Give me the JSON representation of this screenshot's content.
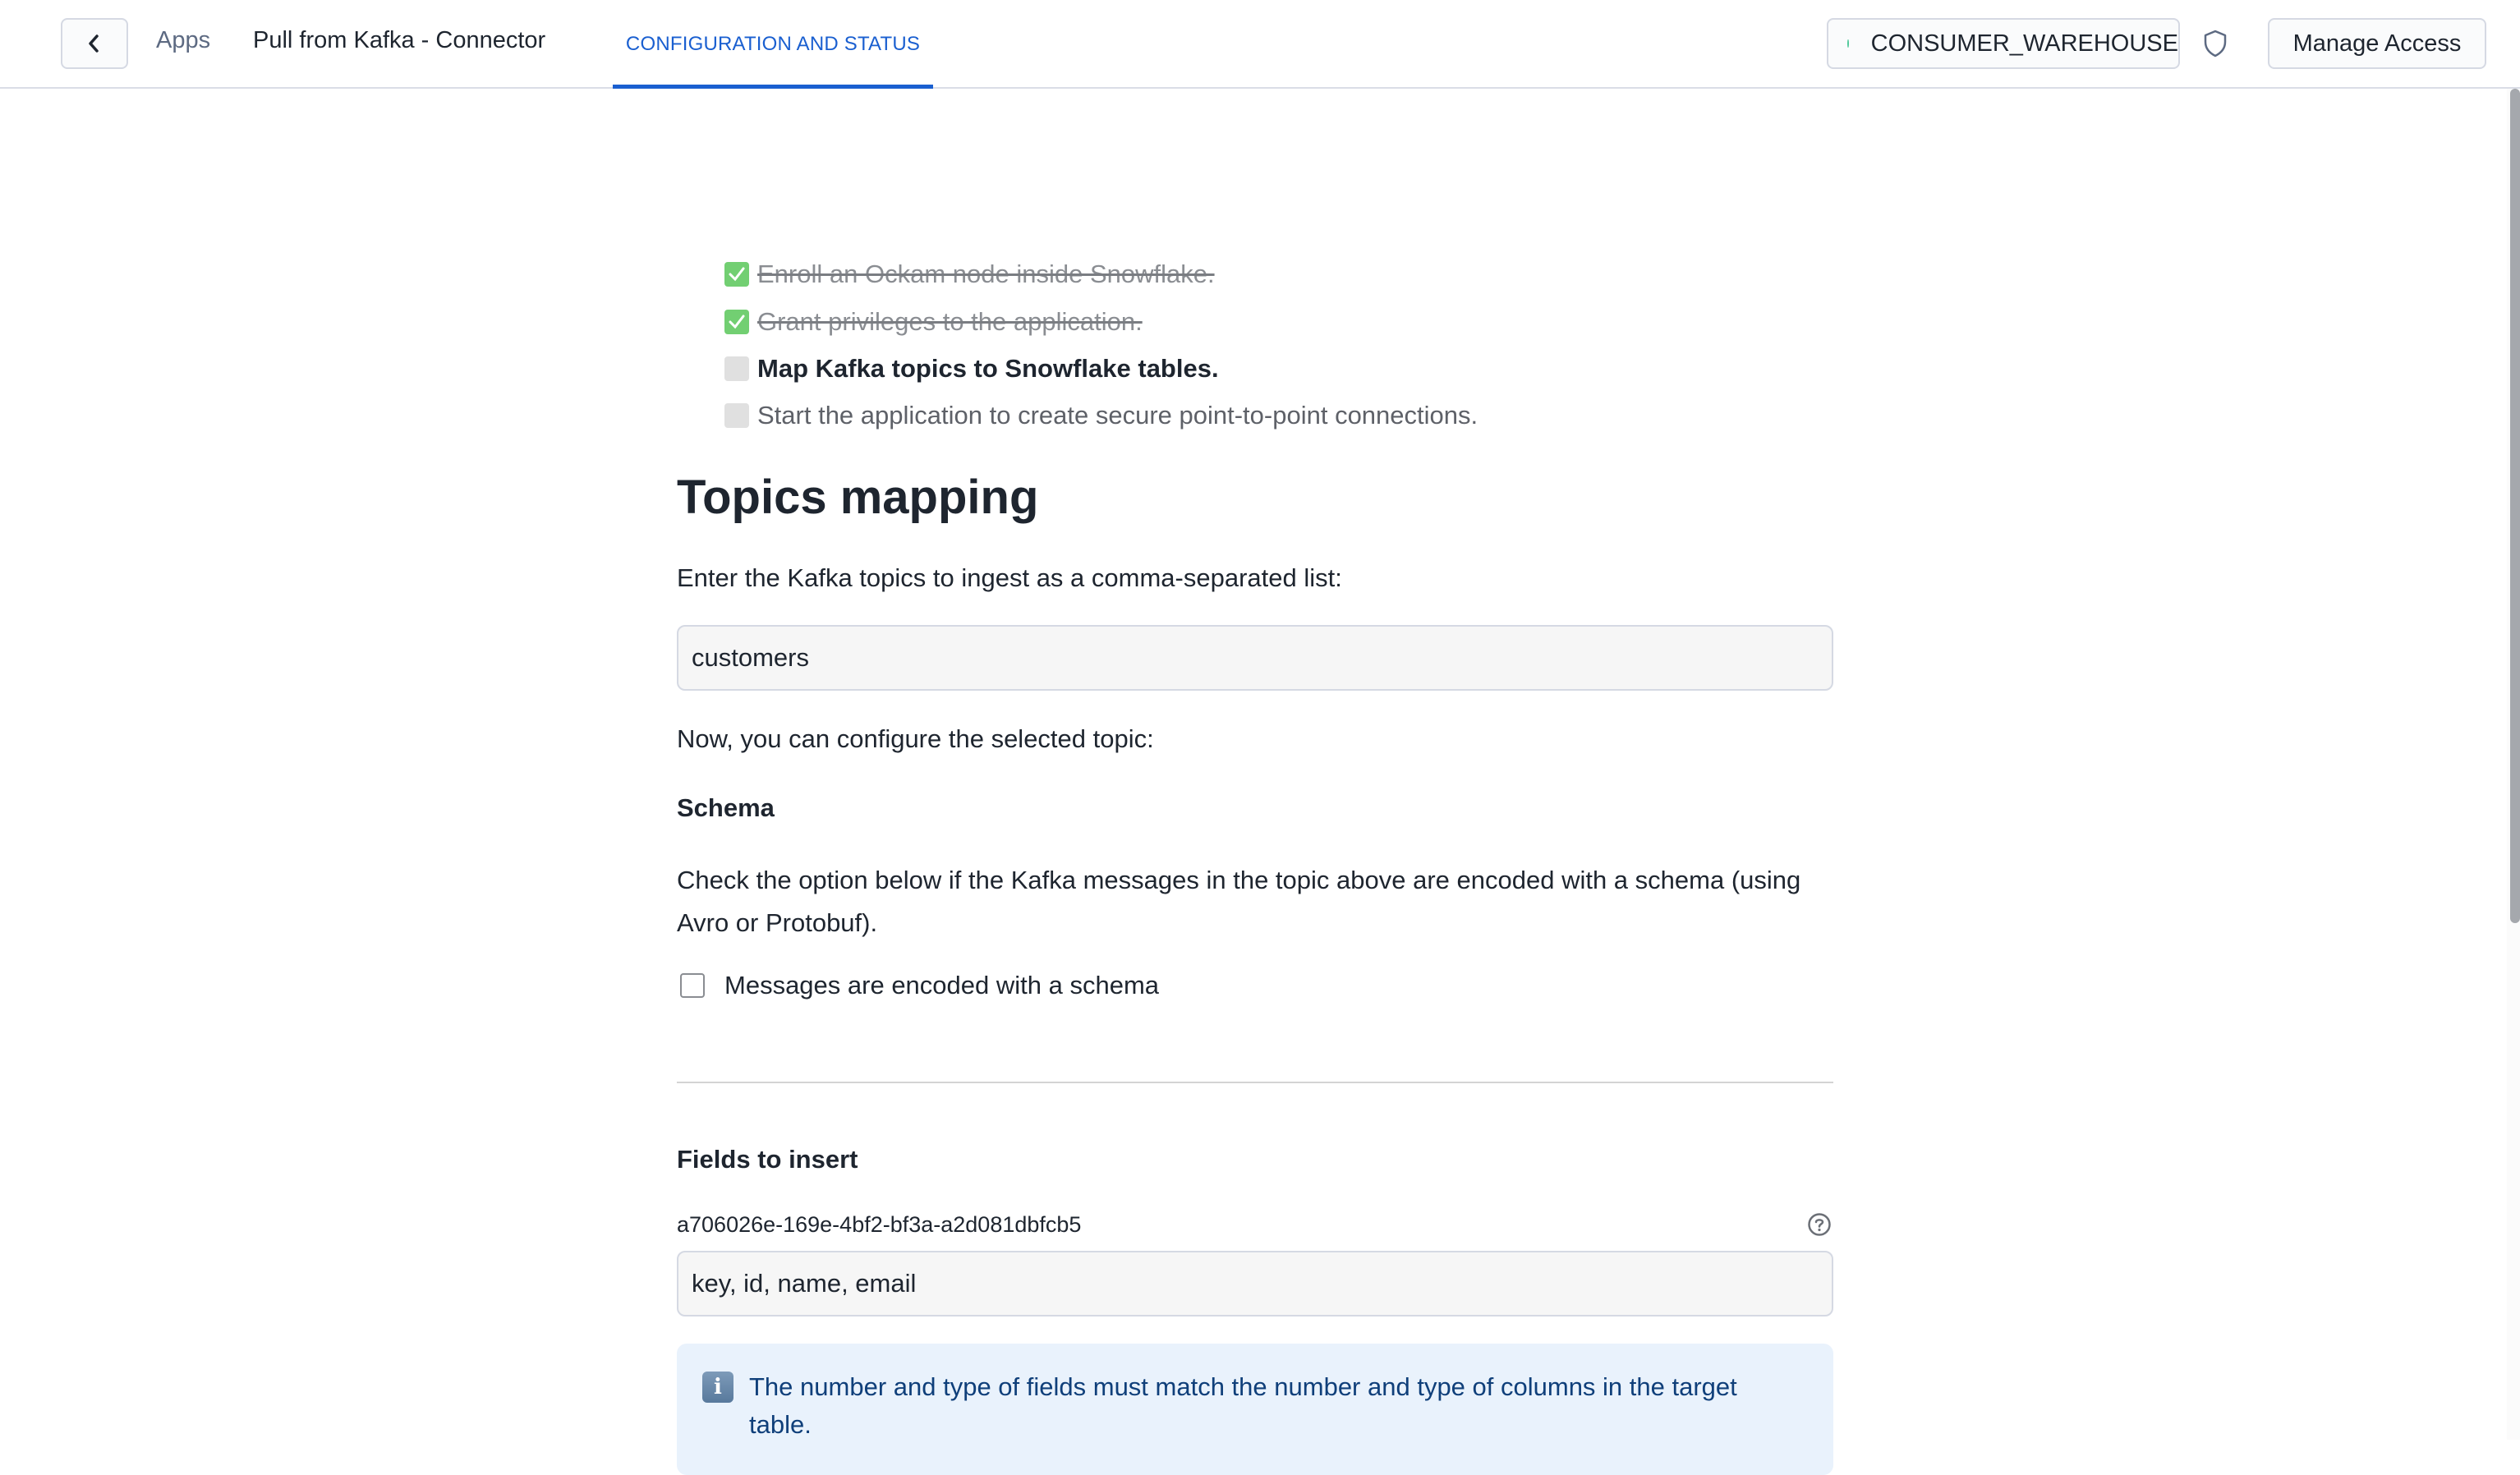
{
  "header": {
    "back_label": "Back",
    "breadcrumb_apps": "Apps",
    "app_title": "Pull from Kafka - Connector",
    "tabs": [
      {
        "label": "CONFIGURATION AND STATUS",
        "active": true
      }
    ],
    "warehouse": {
      "label": "CONSUMER_WAREHOUSE",
      "status_color": "#4fc89a",
      "status": "running"
    },
    "shield_icon": "shield-icon",
    "manage_access_label": "Manage Access"
  },
  "checklist": [
    {
      "label": "Enroll an Ockam node inside Snowflake.",
      "state": "done"
    },
    {
      "label": "Grant privileges to the application.",
      "state": "done"
    },
    {
      "label": "Map Kafka topics to Snowflake tables.",
      "state": "current"
    },
    {
      "label": "Start the application to create secure point-to-point connections.",
      "state": "pending"
    }
  ],
  "topics": {
    "heading": "Topics mapping",
    "prompt": "Enter the Kafka topics to ingest as a comma-separated list:",
    "topics_value": "customers",
    "configure_text": "Now, you can configure the selected topic:"
  },
  "schema": {
    "heading": "Schema",
    "description": "Check the option below if the Kafka messages in the topic above are encoded with a schema (using Avro or Protobuf).",
    "checkbox_label": "Messages are encoded with a schema",
    "checked": false
  },
  "fields": {
    "heading": "Fields to insert",
    "field_id": "a706026e-169e-4bf2-bf3a-a2d081dbfcb5",
    "fields_value": "key, id, name, email",
    "info_icon": "i",
    "info_text": "The number and type of fields must match the number and type of columns in the target table."
  },
  "colors": {
    "accent": "#1a5fd0",
    "done_check": "#72cf72",
    "info_bg": "#e9f2fc",
    "info_text": "#0f3f7a"
  }
}
